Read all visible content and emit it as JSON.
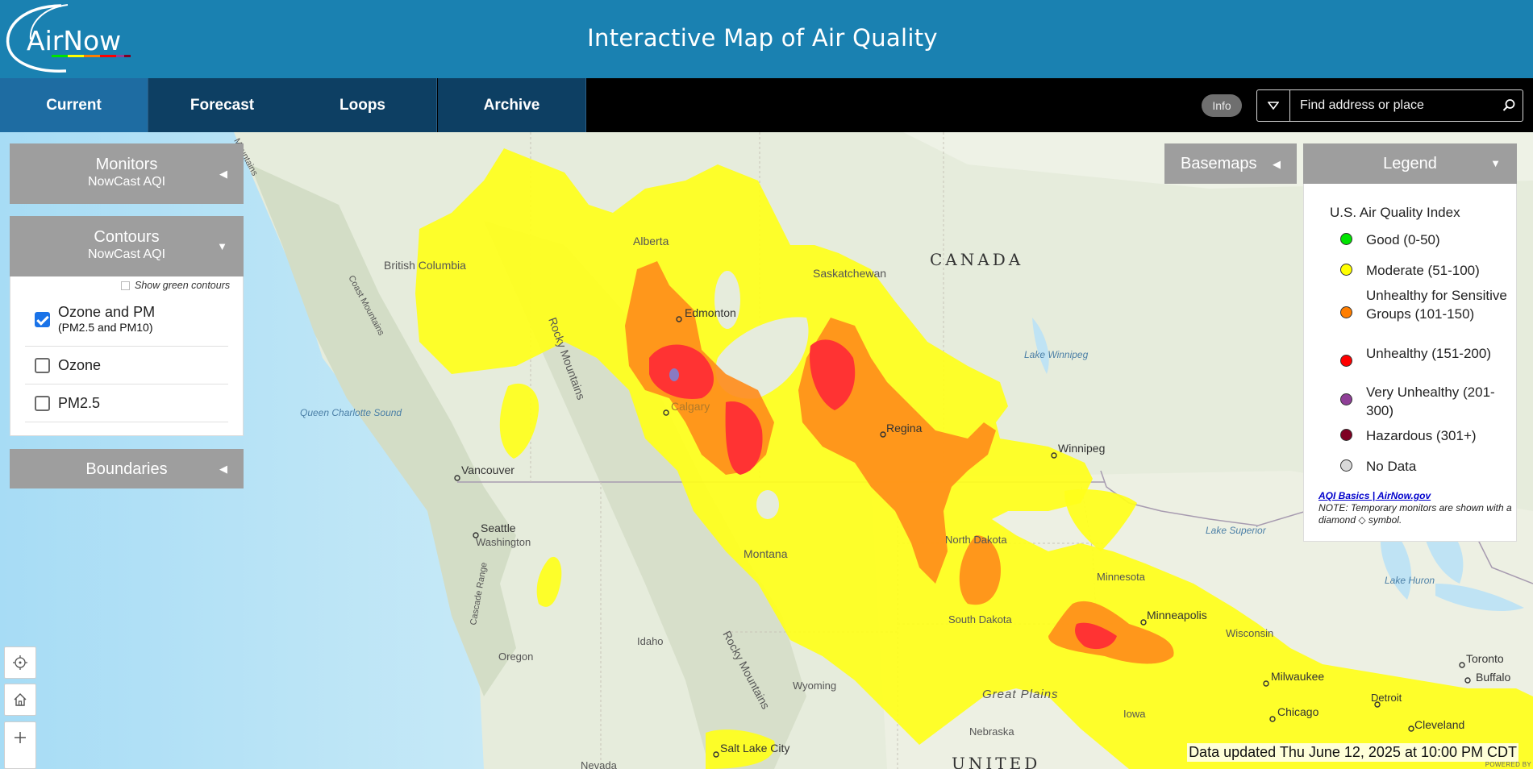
{
  "header": {
    "logo_text": "AirNow",
    "title": "Interactive Map of Air Quality"
  },
  "nav": {
    "tabs": [
      {
        "label": "Current",
        "active": true
      },
      {
        "label": "Forecast"
      },
      {
        "label": "Loops"
      },
      {
        "label": "Archive"
      }
    ],
    "info_label": "Info",
    "search_placeholder": "Find address or place"
  },
  "panels": {
    "monitors": {
      "title": "Monitors",
      "subtitle": "NowCast AQI"
    },
    "contours": {
      "title": "Contours",
      "subtitle": "NowCast AQI",
      "show_green_label": "Show green contours",
      "options": [
        {
          "label": "Ozone and PM",
          "sublabel": "(PM2.5 and PM10)",
          "checked": true
        },
        {
          "label": "Ozone",
          "checked": false
        },
        {
          "label": "PM2.5",
          "checked": false
        }
      ]
    },
    "boundaries": {
      "title": "Boundaries"
    }
  },
  "basemaps_label": "Basemaps",
  "legend": {
    "title": "Legend",
    "index_title": "U.S. Air Quality Index",
    "items": [
      {
        "label": "Good (0-50)",
        "color": "#00e400"
      },
      {
        "label": "Moderate (51-100)",
        "color": "#ffff00"
      },
      {
        "label": "Unhealthy for Sensitive Groups (101-150)",
        "color": "#ff7e00"
      },
      {
        "label": "Unhealthy (151-200)",
        "color": "#ff0000"
      },
      {
        "label": "Very Unhealthy (201-300)",
        "color": "#8f3f97"
      },
      {
        "label": "Hazardous (301+)",
        "color": "#7e0023"
      },
      {
        "label": "No Data",
        "color": "#d9d9d9"
      }
    ],
    "link_text": "AQI Basics | AirNow.gov",
    "note": "NOTE: Temporary monitors are shown with a diamond ◇ symbol."
  },
  "map_labels": {
    "canada": "CANADA",
    "united": "UNITED",
    "alberta": "Alberta",
    "saskatchewan": "Saskatchewan",
    "british_columbia": "British Columbia",
    "edmonton": "Edmonton",
    "calgary": "Calgary",
    "regina": "Regina",
    "winnipeg": "Winnipeg",
    "lake_winnipeg": "Lake Winnipeg",
    "vancouver": "Vancouver",
    "seattle": "Seattle",
    "washington": "Washington",
    "oregon": "Oregon",
    "idaho": "Idaho",
    "montana": "Montana",
    "wyoming": "Wyoming",
    "north_dakota": "North Dakota",
    "south_dakota": "South Dakota",
    "minnesota": "Minnesota",
    "minneapolis": "Minneapolis",
    "wisconsin": "Wisconsin",
    "iowa": "Iowa",
    "nebraska": "Nebraska",
    "milwaukee": "Milwaukee",
    "chicago": "Chicago",
    "detroit": "Detroit",
    "cleveland": "Cleveland",
    "toronto": "Toronto",
    "buffalo": "Buffalo",
    "salt_lake_city": "Salt Lake City",
    "nevada": "Nevada",
    "great_plains": "Great Plains",
    "rocky_mountains": "Rocky Mountains",
    "coast_mountains": "Coast Mountains",
    "cascade_range": "Cascade Range",
    "queen_charlotte_sound": "Queen Charlotte Sound",
    "lake_huron": "Lake Huron",
    "lake_superior": "Lake Superior",
    "mountains": "Mountains"
  },
  "footer": {
    "updated_text": "Data updated Thu June 12, 2025 at 10:00 PM CDT",
    "powered_text": "POWERED BY"
  }
}
